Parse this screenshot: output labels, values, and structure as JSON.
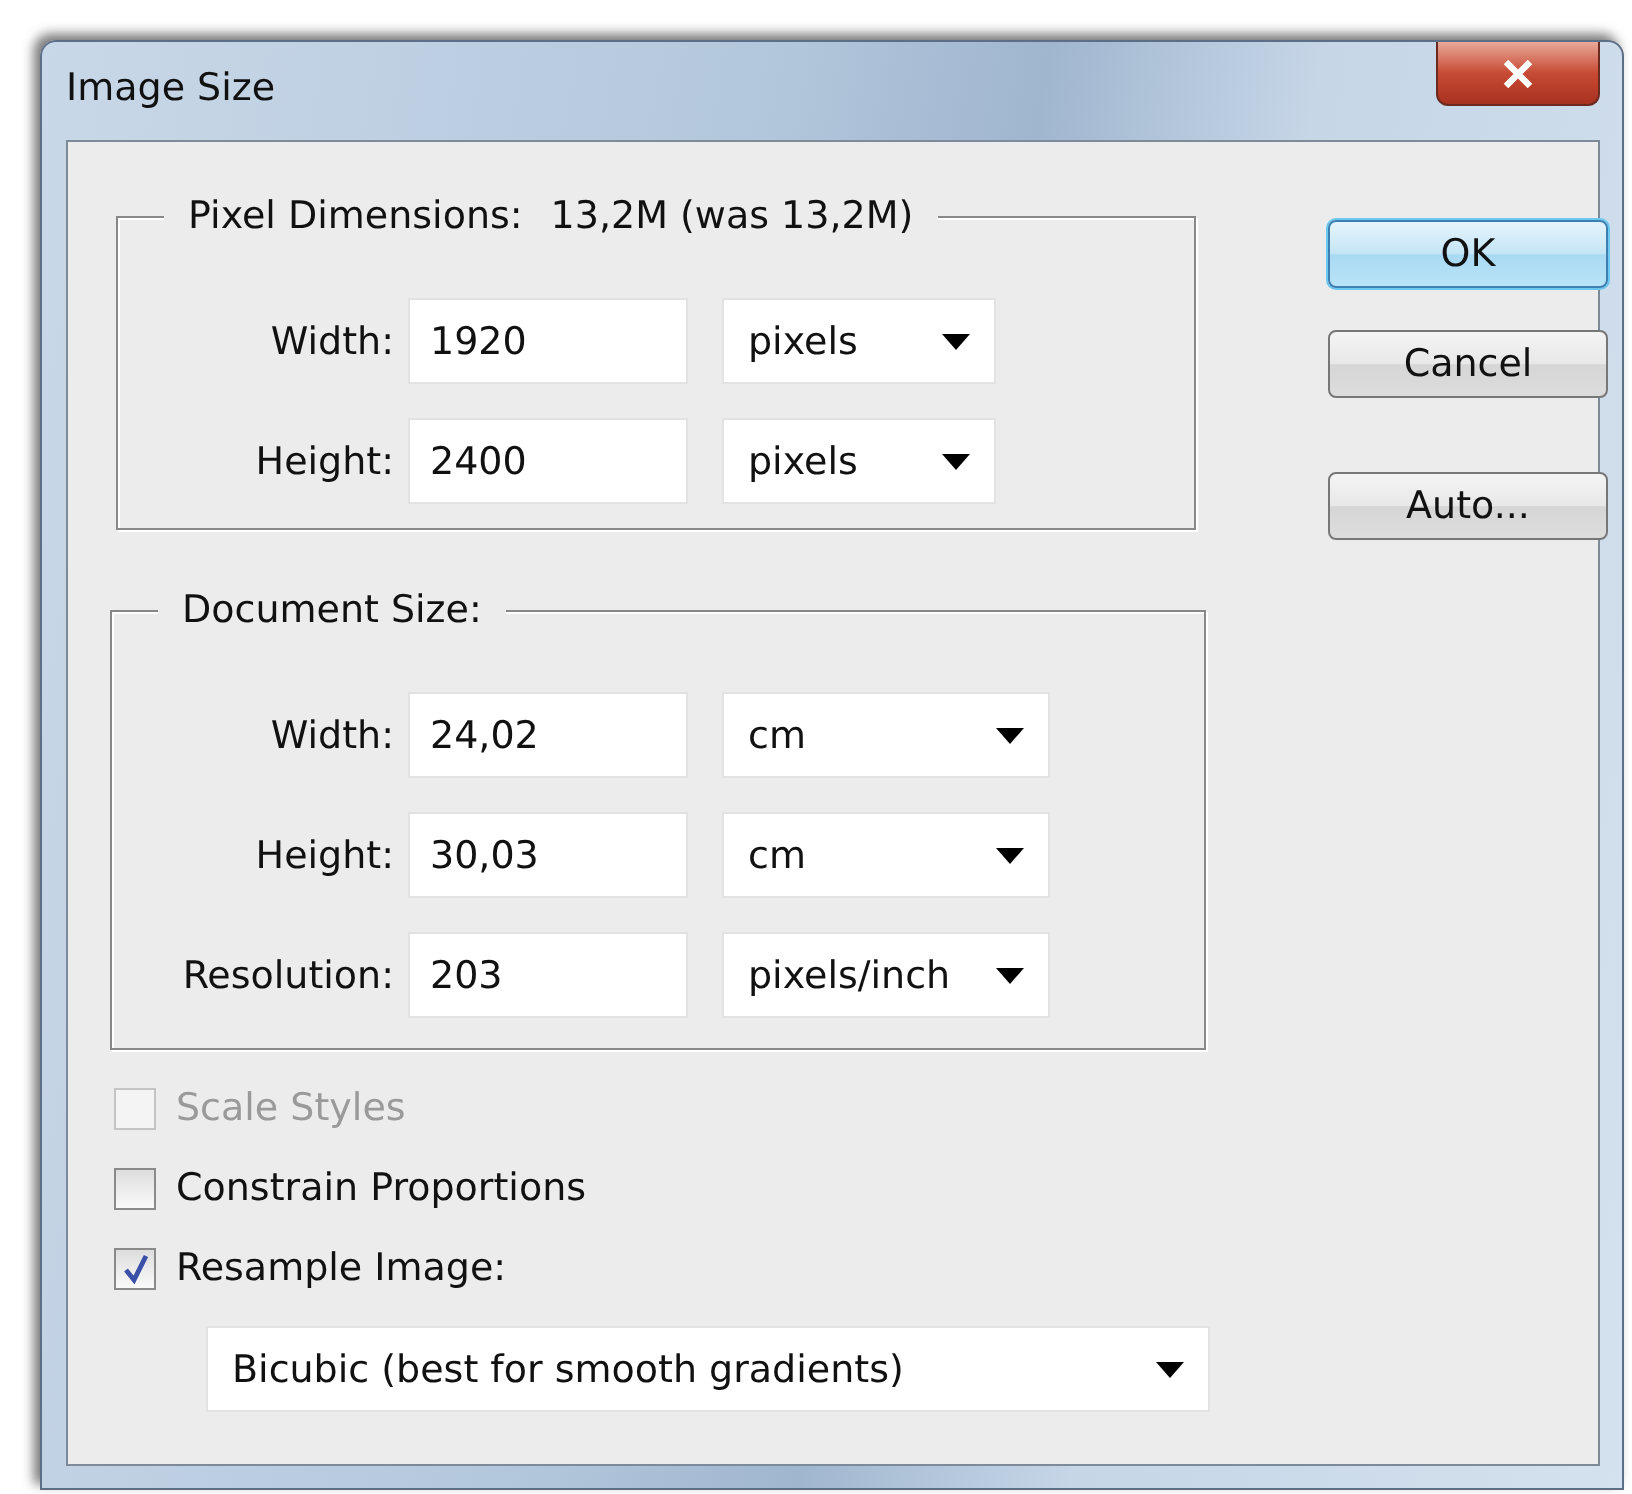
{
  "window": {
    "title": "Image Size"
  },
  "pixel_dimensions": {
    "title": "Pixel Dimensions:",
    "size": "13,2M (was 13,2M)",
    "fields": [
      {
        "label": "Width:",
        "value": "1920",
        "unit": "pixels"
      },
      {
        "label": "Height:",
        "value": "2400",
        "unit": "pixels"
      }
    ]
  },
  "document_size": {
    "title": "Document Size:",
    "fields": [
      {
        "label": "Width:",
        "value": "24,02",
        "unit": "cm"
      },
      {
        "label": "Height:",
        "value": "30,03",
        "unit": "cm"
      },
      {
        "label": "Resolution:",
        "value": "203",
        "unit": "pixels/inch"
      }
    ]
  },
  "options": [
    {
      "label": "Scale Styles",
      "checked": false,
      "disabled": true
    },
    {
      "label": "Constrain Proportions",
      "checked": false,
      "disabled": false
    },
    {
      "label": "Resample Image:",
      "checked": true,
      "disabled": false
    }
  ],
  "resample_method": "Bicubic (best for smooth gradients)",
  "buttons": [
    {
      "label": "OK",
      "default": true
    },
    {
      "label": "Cancel",
      "default": false
    },
    {
      "label": "Auto...",
      "default": false
    }
  ]
}
